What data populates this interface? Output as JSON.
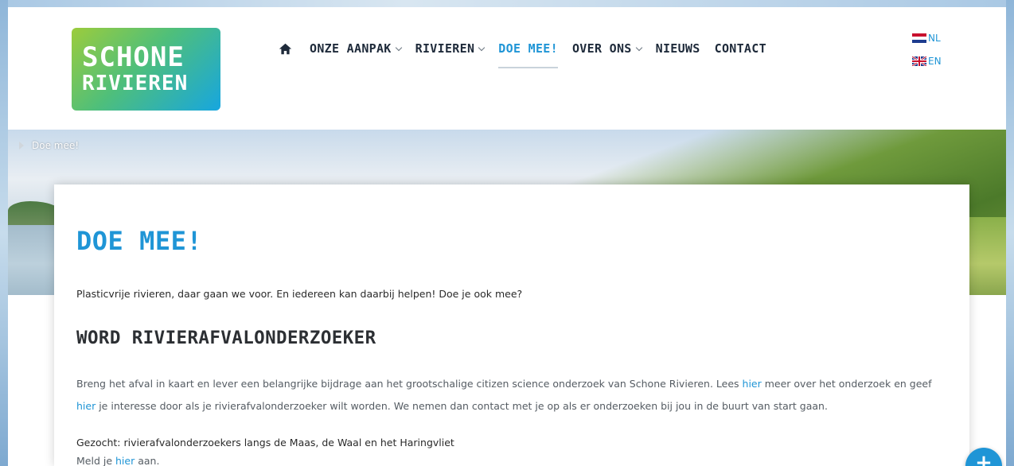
{
  "logo": {
    "line1": "SCHONE",
    "line2": "RIVIEREN"
  },
  "nav": {
    "items": [
      {
        "label": "ONZE AANPAK",
        "has_dropdown": true
      },
      {
        "label": "RIVIEREN",
        "has_dropdown": true
      },
      {
        "label": "DOE MEE!",
        "has_dropdown": false,
        "active": true
      },
      {
        "label": "OVER ONS",
        "has_dropdown": true
      },
      {
        "label": "NIEUWS",
        "has_dropdown": false
      },
      {
        "label": "CONTACT",
        "has_dropdown": false
      }
    ],
    "home_icon": "home-icon"
  },
  "languages": [
    {
      "code": "NL",
      "flag": "netherlands-flag"
    },
    {
      "code": "EN",
      "flag": "uk-flag"
    }
  ],
  "breadcrumb": {
    "label": "Doe mee!"
  },
  "content": {
    "title": "DOE MEE!",
    "intro": "Plasticvrije rivieren, daar gaan we voor. En iedereen kan daarbij helpen! Doe je ook mee?",
    "section_title": "WORD RIVIERAFVALONDERZOEKER",
    "para_part1": "Breng het afval in kaart en lever een belangrijke bijdrage aan het grootschalige citizen science onderzoek van Schone Rivieren. Lees ",
    "para_link1": "hier",
    "para_part2": " meer over het onderzoek en geef ",
    "para_link2": "hier",
    "para_part3": " je interesse door als je rivierafvalonderzoeker wilt worden. We nemen dan contact met je op als er onderzoeken bij jou in de buurt van start gaan.",
    "wanted": "Gezocht: rivierafvalonderzoekers langs de Maas, de Waal en het Haringvliet",
    "signup_part1": "Meld je ",
    "signup_link": "hier",
    "signup_part2": " aan."
  },
  "colors": {
    "accent": "#1f95d6",
    "dark": "#1e2a3a"
  },
  "fab": {
    "label": "+"
  }
}
